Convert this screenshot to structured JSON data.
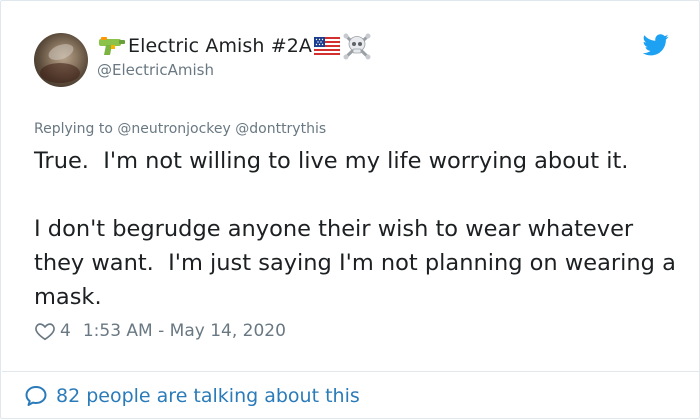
{
  "author": {
    "display_name": "Electric Amish #2A",
    "handle": "@ElectricAmish",
    "name_emojis": [
      "water-pistol-icon",
      "us-flag-icon",
      "skull-crossbones-icon"
    ]
  },
  "reply": {
    "prefix": "Replying to",
    "mentions": [
      "@neutronjockey",
      "@donttrythis"
    ]
  },
  "tweet": {
    "text": "True.  I'm not willing to live my life worrying about it.\n\nI don't begrudge anyone their wish to wear whatever they want.  I'm just saying I'm not planning on wearing a mask."
  },
  "meta": {
    "like_count": "4",
    "timestamp": "1:53 AM - May 14, 2020"
  },
  "footer": {
    "talking_label": "82 people are talking about this"
  },
  "colors": {
    "twitter_blue": "#1da1f2",
    "link_blue": "#2b7bb9",
    "secondary_text": "#697882",
    "border": "#e1e8ed"
  }
}
